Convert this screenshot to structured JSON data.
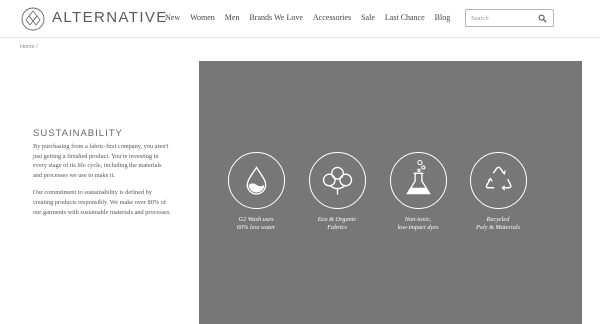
{
  "header": {
    "brand": "ALTERNATIVE",
    "logo_icon": "diamond-logo-icon",
    "nav": [
      "New",
      "Women",
      "Men",
      "Brands We Love",
      "Accessories",
      "Sale",
      "Last Chance",
      "Blog"
    ],
    "search": {
      "placeholder": "Search",
      "icon": "search-icon"
    }
  },
  "breadcrumb": "Home  /",
  "content": {
    "title": "SUSTAINABILITY",
    "paragraph1": "By purchasing from a fabric-first company, you aren't just getting a finished product. You're investing in every stage of its life cycle, including the materials and processes we use to make it.",
    "paragraph2": "Our commitment to sustainability is defined by creating products responsibly. We make over 80% of our garments with sustainable materials and processes."
  },
  "panel": {
    "background": "#777777",
    "features": [
      {
        "icon": "water-drop-icon",
        "line1": "G2 Wash uses",
        "line2": "60% less water"
      },
      {
        "icon": "cotton-flower-icon",
        "line1": "Eco & Organic",
        "line2": "Fabrics"
      },
      {
        "icon": "flask-icon",
        "line1": "Non-toxic,",
        "line2": "low-impact dyes"
      },
      {
        "icon": "recycle-icon",
        "line1": "Recycled",
        "line2": "Poly & Materials"
      }
    ]
  }
}
